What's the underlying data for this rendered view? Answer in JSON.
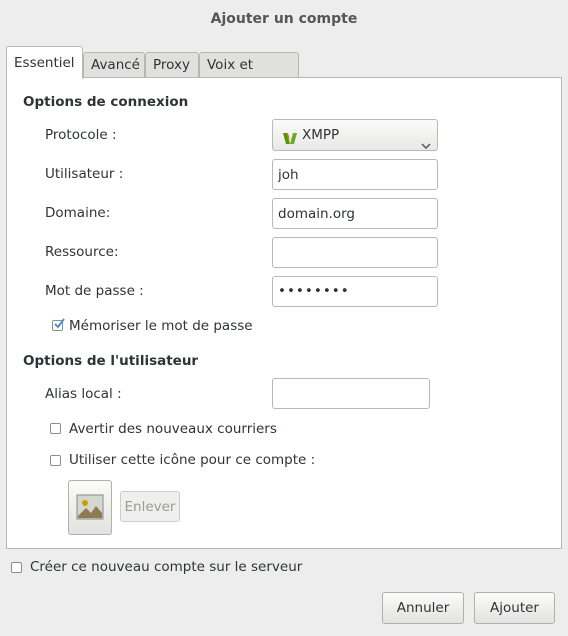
{
  "dialog": {
    "title": "Ajouter un compte"
  },
  "tabs": [
    {
      "label": "Essentiel"
    },
    {
      "label": "Avancé"
    },
    {
      "label": "Proxy"
    },
    {
      "label": "Voix et vidéo"
    }
  ],
  "connection": {
    "heading": "Options de connexion",
    "protocol_label": "Protocole :",
    "protocol_value": "XMPP",
    "username_label": "Utilisateur :",
    "username_value": "joh",
    "domain_label": "Domaine:",
    "domain_value": "domain.org",
    "resource_label": "Ressource:",
    "resource_value": "",
    "password_label": "Mot de passe :",
    "password_value": "••••••••",
    "remember_label": "Mémoriser le mot de passe",
    "remember_checked": true
  },
  "user": {
    "heading": "Options de l'utilisateur",
    "alias_label": "Alias local :",
    "alias_value": "",
    "notify_mail_label": "Avertir des nouveaux courriers",
    "notify_mail_checked": false,
    "use_icon_label": "Utiliser cette icône pour ce compte :",
    "use_icon_checked": false,
    "remove_label": "Enlever"
  },
  "footer": {
    "create_on_server_label": "Créer ce nouveau compte sur le serveur",
    "create_on_server_checked": false,
    "cancel_label": "Annuler",
    "add_label": "Ajouter"
  },
  "colors": {
    "check_accent": "#4a90d9",
    "protocol_icon": "#4e9a06"
  },
  "icons": {
    "protocol": "xmpp-icon",
    "dropdown": "chevron-down-icon",
    "avatar": "image-icon"
  }
}
